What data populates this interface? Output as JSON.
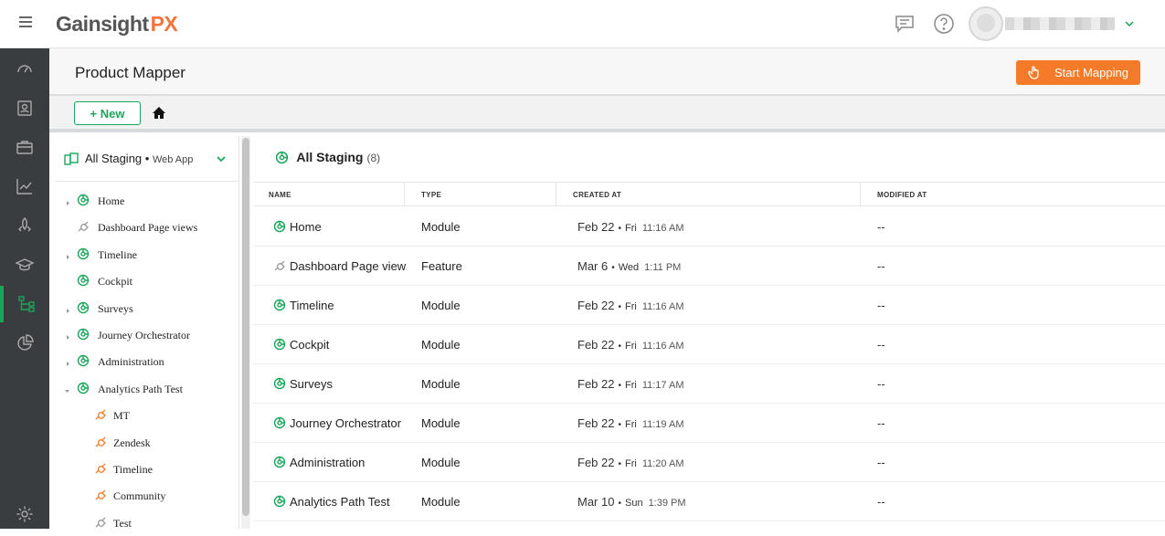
{
  "app": {
    "logo_text": "Gainsight",
    "logo_accent": "PX",
    "accent_color": "#1aa65a",
    "brand_orange": "#f47b2a"
  },
  "header": {
    "title": "Product Mapper",
    "start_button": "Start Mapping"
  },
  "toolbar": {
    "new_label": "+ New"
  },
  "tree": {
    "select_label": "All Staging",
    "select_sub": "Web App",
    "items": [
      {
        "label": "Home",
        "toggle": "collapsed",
        "icon": "module-icon"
      },
      {
        "label": "Dashboard Page views",
        "toggle": "none",
        "icon": "feature-icon"
      },
      {
        "label": "Timeline",
        "toggle": "collapsed",
        "icon": "module-icon"
      },
      {
        "label": "Cockpit",
        "toggle": "none",
        "icon": "module-icon"
      },
      {
        "label": "Surveys",
        "toggle": "collapsed",
        "icon": "module-icon"
      },
      {
        "label": "Journey Orchestrator",
        "toggle": "collapsed",
        "icon": "module-icon"
      },
      {
        "label": "Administration",
        "toggle": "collapsed",
        "icon": "module-icon"
      },
      {
        "label": "Analytics Path Test",
        "toggle": "expanded",
        "icon": "module-icon"
      },
      {
        "label": "MT",
        "toggle": "child",
        "icon": "feature-orange-icon"
      },
      {
        "label": "Zendesk",
        "toggle": "child",
        "icon": "feature-orange-icon"
      },
      {
        "label": "Timeline",
        "toggle": "child",
        "icon": "feature-orange-icon"
      },
      {
        "label": "Community",
        "toggle": "child",
        "icon": "feature-orange-icon"
      },
      {
        "label": "Test",
        "toggle": "child",
        "icon": "feature-icon"
      }
    ]
  },
  "main": {
    "title": "All Staging",
    "count": "(8)",
    "columns": [
      "NAME",
      "TYPE",
      "CREATED AT",
      "MODIFIED AT"
    ],
    "rows": [
      {
        "name": "Home",
        "type": "Module",
        "date": "Feb 22",
        "dow": "Fri",
        "time": "11:16 AM",
        "modified": "--",
        "icon": "module-icon"
      },
      {
        "name": "Dashboard Page views",
        "type": "Feature",
        "date": "Mar 6",
        "dow": "Wed",
        "time": "1:11 PM",
        "modified": "--",
        "icon": "feature-icon"
      },
      {
        "name": "Timeline",
        "type": "Module",
        "date": "Feb 22",
        "dow": "Fri",
        "time": "11:16 AM",
        "modified": "--",
        "icon": "module-icon"
      },
      {
        "name": "Cockpit",
        "type": "Module",
        "date": "Feb 22",
        "dow": "Fri",
        "time": "11:16 AM",
        "modified": "--",
        "icon": "module-icon"
      },
      {
        "name": "Surveys",
        "type": "Module",
        "date": "Feb 22",
        "dow": "Fri",
        "time": "11:17 AM",
        "modified": "--",
        "icon": "module-icon"
      },
      {
        "name": "Journey Orchestrator",
        "type": "Module",
        "date": "Feb 22",
        "dow": "Fri",
        "time": "11:19 AM",
        "modified": "--",
        "icon": "module-icon"
      },
      {
        "name": "Administration",
        "type": "Module",
        "date": "Feb 22",
        "dow": "Fri",
        "time": "11:20 AM",
        "modified": "--",
        "icon": "module-icon"
      },
      {
        "name": "Analytics Path Test",
        "type": "Module",
        "date": "Mar 10",
        "dow": "Sun",
        "time": "1:39 PM",
        "modified": "--",
        "icon": "module-icon"
      }
    ]
  },
  "leftnav": [
    "speedometer-icon",
    "contacts-icon",
    "briefcase-icon",
    "line-chart-icon",
    "rocket-icon",
    "graduation-cap-icon",
    "product-mapper-icon",
    "pie-chart-icon",
    "settings-icon"
  ]
}
